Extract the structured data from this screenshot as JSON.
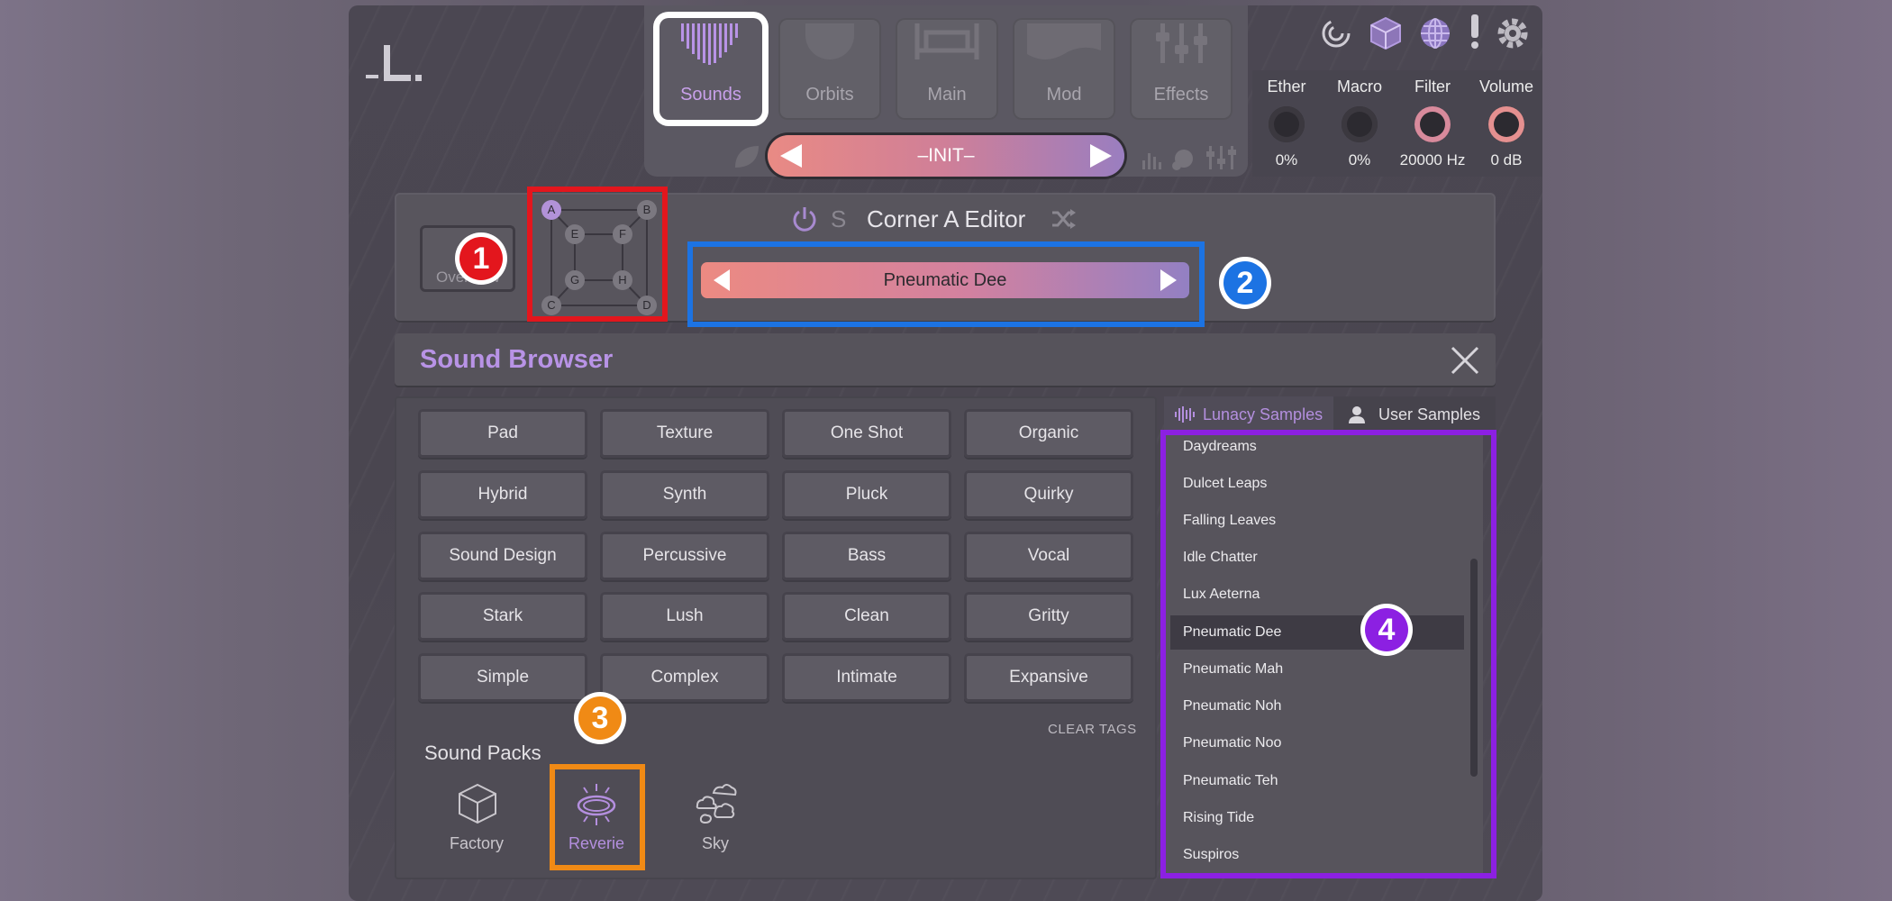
{
  "colors": {
    "accent_purple": "#b893e6",
    "highlight_red": "#e3161d",
    "highlight_blue": "#1c73e3",
    "highlight_orange": "#f08a15",
    "highlight_purple": "#8c20e2"
  },
  "top_tabs": [
    {
      "label": "Sounds",
      "icon": "sounds-waveform-icon",
      "active": true
    },
    {
      "label": "Orbits",
      "icon": "orbits-icon"
    },
    {
      "label": "Main",
      "icon": "main-icon"
    },
    {
      "label": "Mod",
      "icon": "mod-icon"
    },
    {
      "label": "Effects",
      "icon": "effects-sliders-icon"
    }
  ],
  "preset": {
    "name": "–INIT–"
  },
  "header_icons": [
    "spiral-icon",
    "cube-icon",
    "globe-icon",
    "alert-icon",
    "gear-icon"
  ],
  "knobs": [
    {
      "label": "Ether",
      "value": "0%"
    },
    {
      "label": "Macro",
      "value": "0%"
    },
    {
      "label": "Filter",
      "value": "20000 Hz"
    },
    {
      "label": "Volume",
      "value": "0 dB"
    }
  ],
  "editor": {
    "overview_label": "Overview",
    "solo_label": "S",
    "title": "Corner A Editor",
    "corners": [
      "A",
      "B",
      "E",
      "F",
      "G",
      "H",
      "C",
      "D"
    ],
    "sample": "Pneumatic Dee"
  },
  "badges": [
    "1",
    "2",
    "3",
    "4"
  ],
  "browser": {
    "title": "Sound Browser",
    "tags": [
      [
        "Pad",
        "Texture",
        "One Shot",
        "Organic"
      ],
      [
        "Hybrid",
        "Synth",
        "Pluck",
        "Quirky"
      ],
      [
        "Sound Design",
        "Percussive",
        "Bass",
        "Vocal"
      ],
      [
        "Stark",
        "Lush",
        "Clean",
        "Gritty"
      ],
      [
        "Simple",
        "Complex",
        "Intimate",
        "Expansive"
      ]
    ],
    "clear_tags": "CLEAR TAGS",
    "packs_title": "Sound Packs",
    "packs": [
      {
        "label": "Factory",
        "icon": "cube-pack-icon"
      },
      {
        "label": "Reverie",
        "icon": "halo-ring-icon",
        "selected": true
      },
      {
        "label": "Sky",
        "icon": "clouds-icon"
      }
    ]
  },
  "samples": {
    "tab_lunacy": "Lunacy Samples",
    "tab_user": "User Samples",
    "items": [
      "Daydreams",
      "Dulcet Leaps",
      "Falling Leaves",
      "Idle Chatter",
      "Lux Aeterna",
      "Pneumatic Dee",
      "Pneumatic Mah",
      "Pneumatic Noh",
      "Pneumatic Noo",
      "Pneumatic Teh",
      "Rising Tide",
      "Suspiros"
    ],
    "selected": "Pneumatic Dee"
  }
}
